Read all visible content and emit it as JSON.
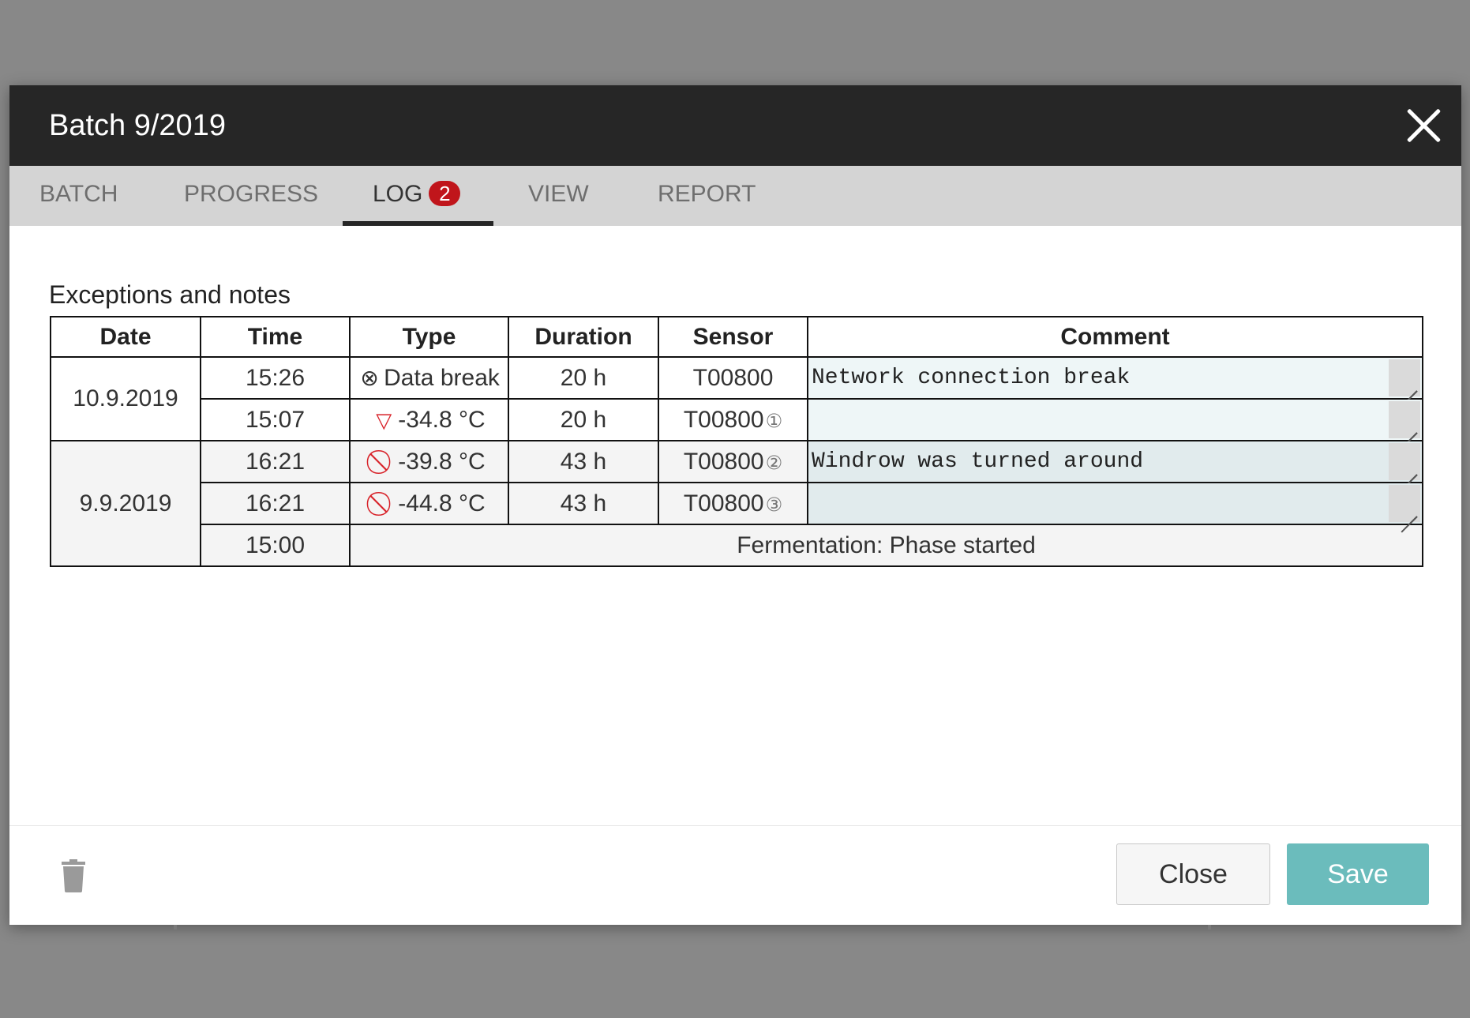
{
  "dialog": {
    "title": "Batch 9/2019"
  },
  "tabs": [
    {
      "label": "BATCH"
    },
    {
      "label": "PROGRESS"
    },
    {
      "label": "LOG",
      "badge": "2"
    },
    {
      "label": "VIEW"
    },
    {
      "label": "REPORT"
    }
  ],
  "active_tab": "LOG",
  "section": {
    "title": "Exceptions and notes"
  },
  "table": {
    "headers": [
      "Date",
      "Time",
      "Type",
      "Duration",
      "Sensor",
      "Comment"
    ],
    "groups": [
      {
        "date": "10.9.2019",
        "rows": [
          {
            "time": "15:26",
            "type_icon": "data-break-icon",
            "type": "Data break",
            "duration": "20 h",
            "sensor": "T00800",
            "sensor_index": "",
            "comment": "Network connection break"
          },
          {
            "time": "15:07",
            "type_icon": "low-limit-triangle-icon",
            "type": "-34.8 °C",
            "duration": "20 h",
            "sensor": "T00800",
            "sensor_index": "①",
            "comment": ""
          }
        ]
      },
      {
        "date": "9.9.2019",
        "rows": [
          {
            "time": "16:21",
            "type_icon": "prohibited-icon",
            "type": "-39.8 °C",
            "duration": "43 h",
            "sensor": "T00800",
            "sensor_index": "②",
            "comment": "Windrow was turned around"
          },
          {
            "time": "16:21",
            "type_icon": "prohibited-icon",
            "type": "-44.8 °C",
            "duration": "43 h",
            "sensor": "T00800",
            "sensor_index": "③",
            "comment": ""
          }
        ],
        "note": {
          "time": "15:00",
          "text": "Fermentation: Phase started"
        }
      }
    ]
  },
  "footer": {
    "delete_icon": "trash-icon",
    "close_label": "Close",
    "save_label": "Save"
  },
  "colors": {
    "header_bg": "#262626",
    "tab_bar_bg": "#d4d4d4",
    "badge": "#c0151b",
    "alert_red": "#d8232a",
    "save_button": "#6bbcbc",
    "comment_field": "#eef6f7"
  }
}
